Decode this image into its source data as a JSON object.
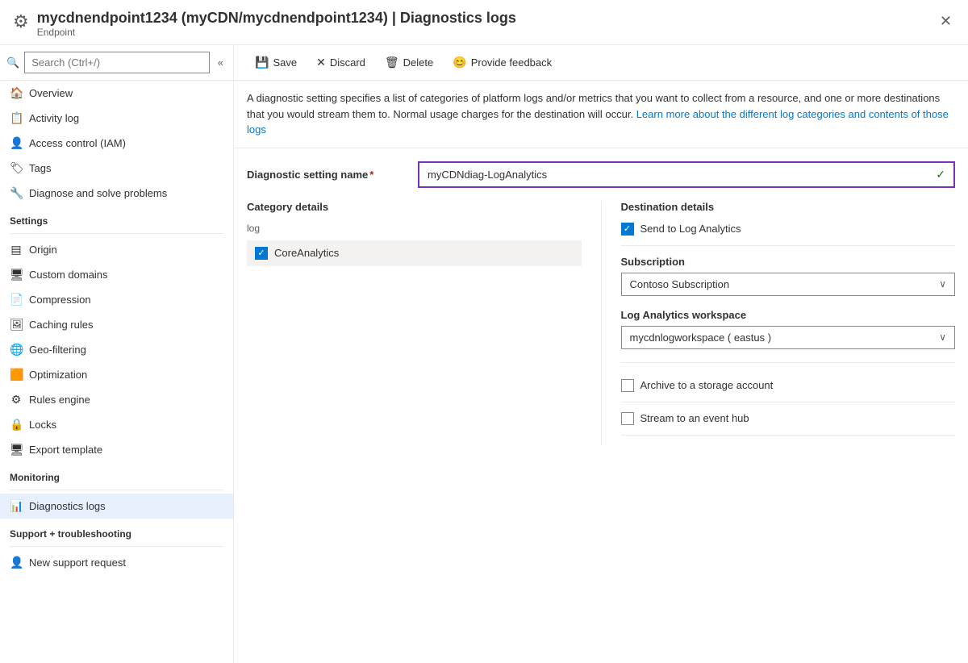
{
  "header": {
    "icon": "⚙",
    "title": "mycdnendpoint1234 (myCDN/mycdnendpoint1234) | Diagnostics logs",
    "subtitle": "Endpoint",
    "close_label": "✕"
  },
  "search": {
    "placeholder": "Search (Ctrl+/)",
    "collapse_icon": "«"
  },
  "nav": {
    "items": [
      {
        "id": "overview",
        "label": "Overview",
        "icon": "🏠"
      },
      {
        "id": "activity-log",
        "label": "Activity log",
        "icon": "📋"
      },
      {
        "id": "access-control",
        "label": "Access control (IAM)",
        "icon": "👤"
      },
      {
        "id": "tags",
        "label": "Tags",
        "icon": "🏷"
      },
      {
        "id": "diagnose",
        "label": "Diagnose and solve problems",
        "icon": "🔧"
      }
    ],
    "settings_header": "Settings",
    "settings_items": [
      {
        "id": "origin",
        "label": "Origin",
        "icon": "▤"
      },
      {
        "id": "custom-domains",
        "label": "Custom domains",
        "icon": "🖥"
      },
      {
        "id": "compression",
        "label": "Compression",
        "icon": "📄"
      },
      {
        "id": "caching-rules",
        "label": "Caching rules",
        "icon": "🖼"
      },
      {
        "id": "geo-filtering",
        "label": "Geo-filtering",
        "icon": "🌐"
      },
      {
        "id": "optimization",
        "label": "Optimization",
        "icon": "🟧"
      },
      {
        "id": "rules-engine",
        "label": "Rules engine",
        "icon": "⚙"
      },
      {
        "id": "locks",
        "label": "Locks",
        "icon": "🔒"
      },
      {
        "id": "export-template",
        "label": "Export template",
        "icon": "🖥"
      }
    ],
    "monitoring_header": "Monitoring",
    "monitoring_items": [
      {
        "id": "diagnostics-logs",
        "label": "Diagnostics logs",
        "icon": "📊",
        "active": true
      }
    ],
    "support_header": "Support + troubleshooting",
    "support_items": [
      {
        "id": "new-support-request",
        "label": "New support request",
        "icon": "👤"
      }
    ]
  },
  "toolbar": {
    "save_label": "Save",
    "save_icon": "💾",
    "discard_label": "Discard",
    "discard_icon": "✕",
    "delete_label": "Delete",
    "delete_icon": "🗑",
    "feedback_label": "Provide feedback",
    "feedback_icon": "😊"
  },
  "description": {
    "text": "A diagnostic setting specifies a list of categories of platform logs and/or metrics that you want to collect from a resource, and one or more destinations that you would stream them to. Normal usage charges for the destination will occur.",
    "link_text": "Learn more about the different log categories and contents of those logs"
  },
  "form": {
    "setting_name_label": "Diagnostic setting name",
    "setting_name_required": "*",
    "setting_name_value": "myCDNdiag-LogAnalytics",
    "category_details_label": "Category details",
    "log_section_label": "log",
    "core_analytics_label": "CoreAnalytics",
    "destination_details_label": "Destination details",
    "send_to_log_analytics_label": "Send to Log Analytics",
    "subscription_label": "Subscription",
    "subscription_value": "Contoso Subscription",
    "workspace_label": "Log Analytics workspace",
    "workspace_value": "mycdnlogworkspace ( eastus )",
    "archive_label": "Archive to a storage account",
    "stream_label": "Stream to an event hub",
    "dropdown_arrow": "∨"
  }
}
